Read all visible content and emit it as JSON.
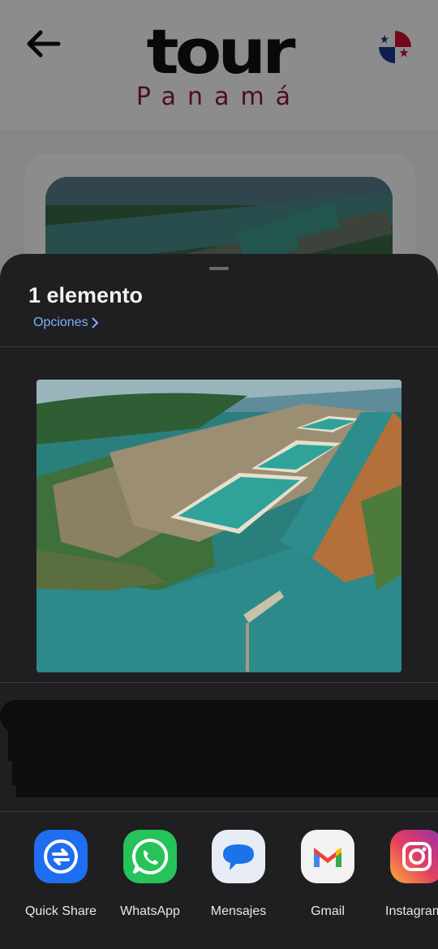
{
  "background_app": {
    "logo_main": "tour",
    "logo_sub": "Panamá"
  },
  "share_sheet": {
    "title": "1 elemento",
    "options_label": "Opciones",
    "apps": [
      {
        "name": "Quick Share",
        "icon": "quick-share-icon",
        "color": "#1f6df0"
      },
      {
        "name": "WhatsApp",
        "icon": "whatsapp-icon",
        "color": "#25c35a"
      },
      {
        "name": "Mensajes",
        "icon": "messages-icon",
        "color": "#1a73e8"
      },
      {
        "name": "Gmail",
        "icon": "gmail-icon",
        "color": "#ea4335"
      },
      {
        "name": "Instagram",
        "icon": "instagram-icon",
        "color": "#d62976"
      }
    ]
  }
}
